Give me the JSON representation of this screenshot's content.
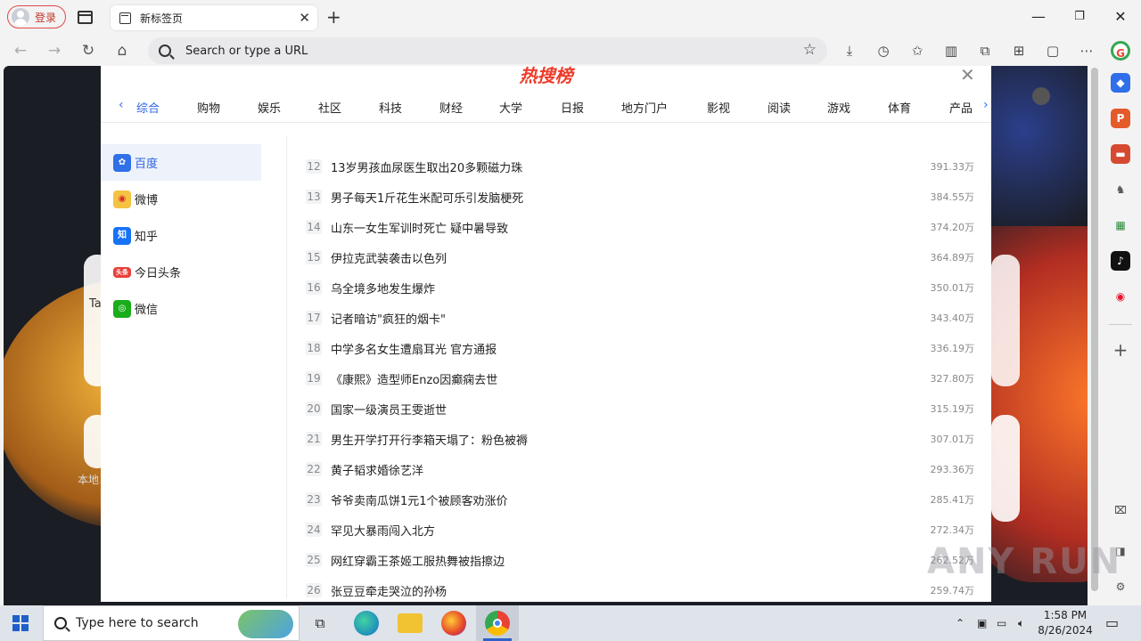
{
  "browser": {
    "profile_label": "登录",
    "tab_title": "新标签页",
    "tab_close": "✕",
    "new_tab": "+",
    "address_placeholder": "Search  or type a URL",
    "window_controls": {
      "minimize": "—",
      "maximize": "❐",
      "close": "✕"
    }
  },
  "modal": {
    "title": "热搜榜",
    "close": "✕",
    "categories": [
      "综合",
      "购物",
      "娱乐",
      "社区",
      "科技",
      "财经",
      "大学",
      "日报",
      "地方门户",
      "影视",
      "阅读",
      "游戏",
      "体育",
      "产品"
    ],
    "active_category": "综合",
    "sources": [
      {
        "name": "百度",
        "icon": "baidu-icon",
        "color": "#3070e8"
      },
      {
        "name": "微博",
        "icon": "weibo-icon",
        "color": "#f5c242"
      },
      {
        "name": "知乎",
        "icon": "zhihu-icon",
        "color": "#1772f6"
      },
      {
        "name": "今日头条",
        "icon": "toutiao-icon",
        "color": "#e8403a"
      },
      {
        "name": "微信",
        "icon": "wechat-icon",
        "color": "#1aad19"
      }
    ],
    "active_source": "百度",
    "hot_items": [
      {
        "rank": "12",
        "title": "13岁男孩血尿医生取出20多颗磁力珠",
        "value": "391.33万"
      },
      {
        "rank": "13",
        "title": "男子每天1斤花生米配可乐引发脑梗死",
        "value": "384.55万"
      },
      {
        "rank": "14",
        "title": "山东一女生军训时死亡 疑中暑导致",
        "value": "374.20万"
      },
      {
        "rank": "15",
        "title": "伊拉克武装袭击以色列",
        "value": "364.89万"
      },
      {
        "rank": "16",
        "title": "乌全境多地发生爆炸",
        "value": "350.01万"
      },
      {
        "rank": "17",
        "title": "记者暗访\"疯狂的烟卡\"",
        "value": "343.40万"
      },
      {
        "rank": "18",
        "title": "中学多名女生遭扇耳光 官方通报",
        "value": "336.19万"
      },
      {
        "rank": "19",
        "title": "《康熙》造型师Enzo因癫痫去世",
        "value": "327.80万"
      },
      {
        "rank": "20",
        "title": "国家一级演员王雯逝世",
        "value": "315.19万"
      },
      {
        "rank": "21",
        "title": "男生开学打开行李箱天塌了：粉色被褥",
        "value": "307.01万"
      },
      {
        "rank": "22",
        "title": "黄子韬求婚徐艺洋",
        "value": "293.36万"
      },
      {
        "rank": "23",
        "title": "爷爷卖南瓜饼1元1个被顾客劝涨价",
        "value": "285.41万"
      },
      {
        "rank": "24",
        "title": "罕见大暴雨闯入北方",
        "value": "272.34万"
      },
      {
        "rank": "25",
        "title": "网红穿霸王茶姬工服热舞被指擦边",
        "value": "262.52万"
      },
      {
        "rank": "26",
        "title": "张豆豆牵走哭泣的孙杨",
        "value": "259.74万"
      }
    ]
  },
  "background_labels": {
    "partial_text": "Ta",
    "partial_local": "本地"
  },
  "taskbar": {
    "search_placeholder": "Type here to search",
    "time": "1:58 PM",
    "date": "8/26/2024"
  },
  "watermark": "ANY RUN"
}
